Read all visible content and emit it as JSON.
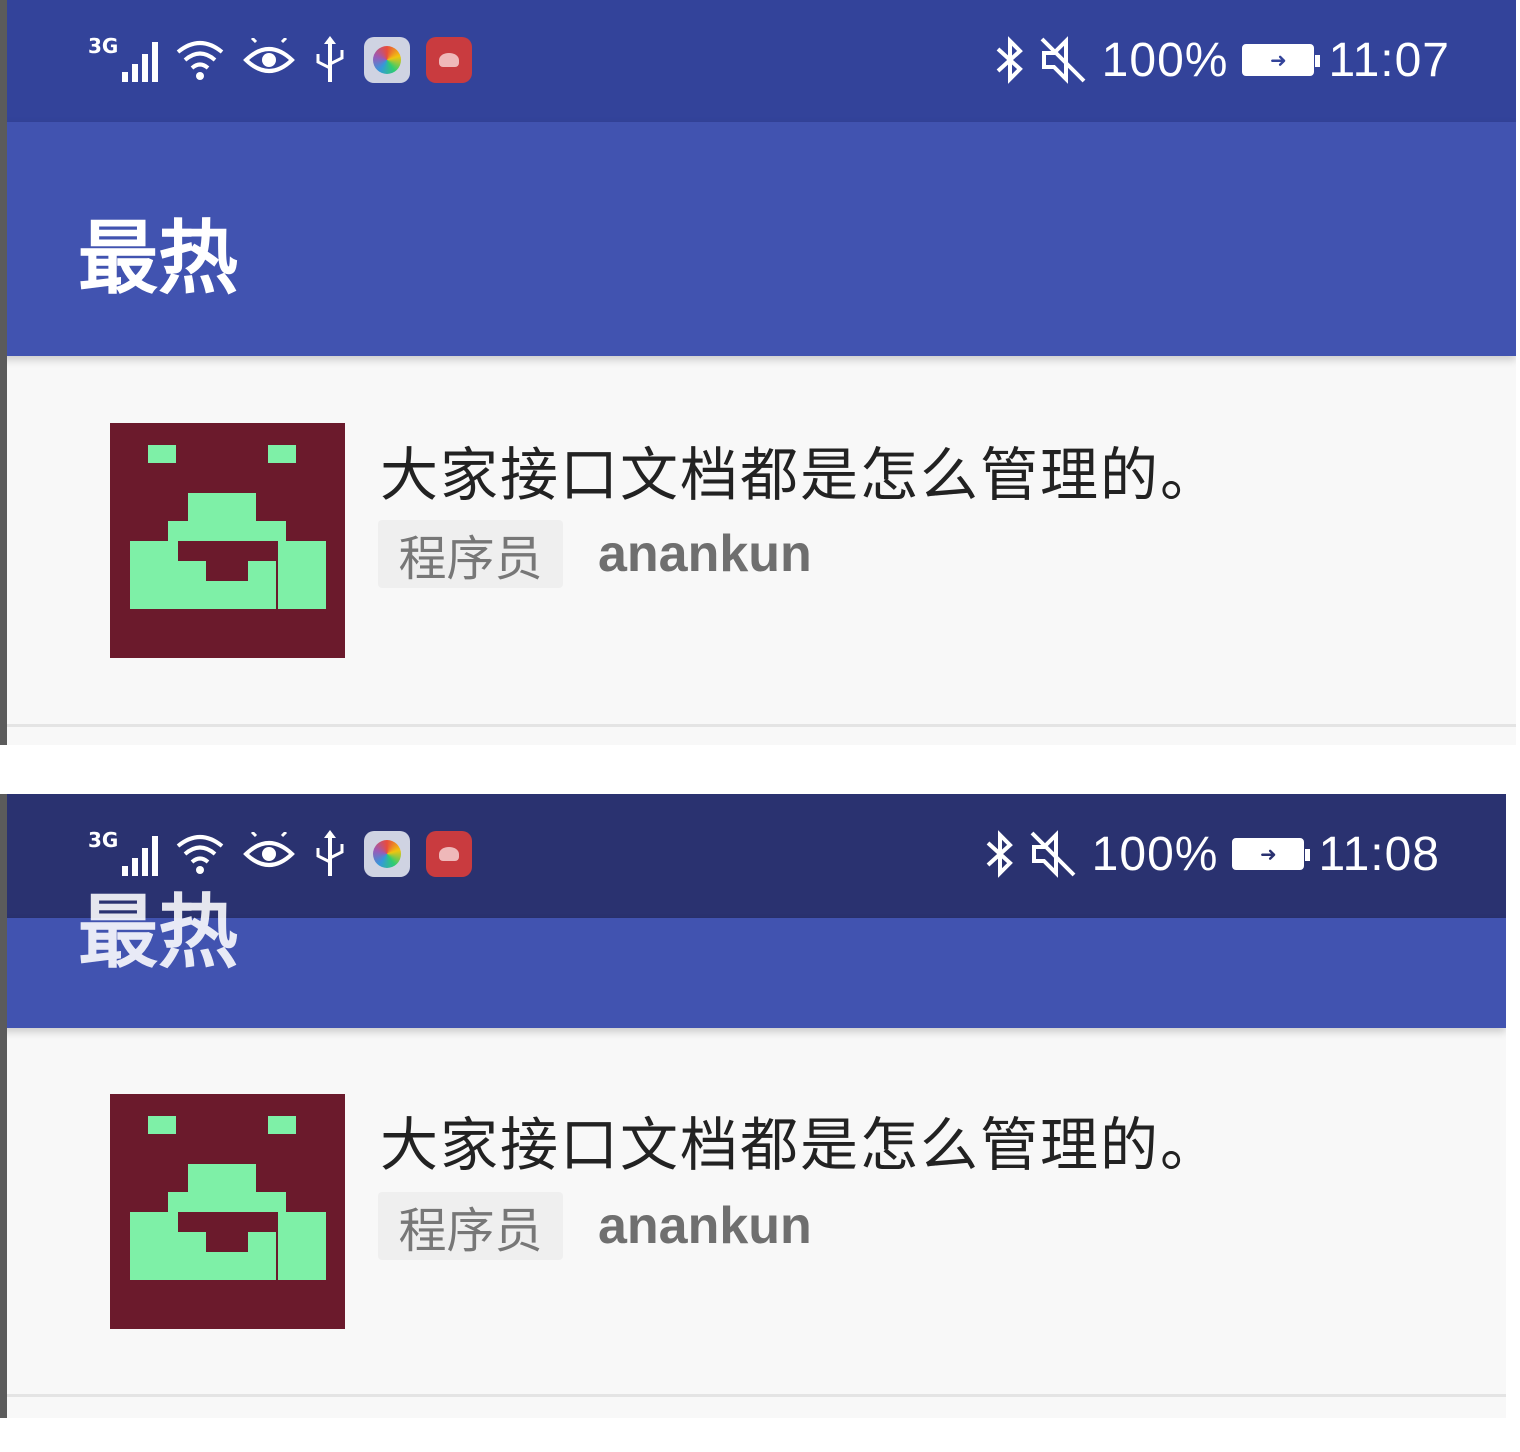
{
  "screens": [
    {
      "status_bar": {
        "network": "3G",
        "battery_percent": "100%",
        "time": "11:07"
      },
      "toolbar": {
        "title": "最热"
      },
      "item": {
        "title": "大家接口文档都是怎么管理的。",
        "tag": "程序员",
        "author": "anankun"
      }
    },
    {
      "status_bar": {
        "network": "3G",
        "battery_percent": "100%",
        "time": "11:08"
      },
      "toolbar": {
        "title": "最热"
      },
      "item": {
        "title": "大家接口文档都是怎么管理的。",
        "tag": "程序员",
        "author": "anankun"
      }
    }
  ],
  "colors": {
    "status_bar_1": "#33439a",
    "status_bar_2": "#2a3270",
    "toolbar": "#4153b0",
    "avatar_bg": "#6b1a2c",
    "avatar_fg": "#7ef0a7",
    "tag_bg": "#efefef"
  },
  "icons": [
    "signal-icon",
    "wifi-icon",
    "eye-icon",
    "usb-icon",
    "photos-app-icon",
    "huawei-app-icon",
    "bluetooth-icon",
    "mute-icon",
    "battery-icon"
  ]
}
